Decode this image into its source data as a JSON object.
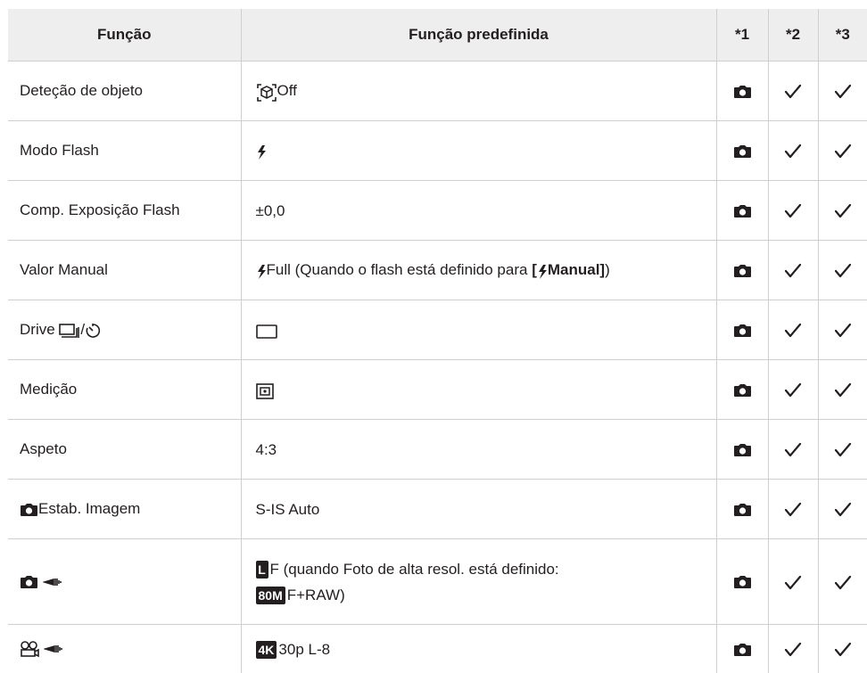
{
  "header": {
    "col_function": "Função",
    "col_default": "Função predefinida",
    "col_1": "*1",
    "col_2": "*2",
    "col_3": "*3"
  },
  "rows": [
    {
      "function": "Deteção de objeto",
      "default": "Off",
      "icons": [
        "object-detect-icon"
      ]
    },
    {
      "function": "Modo Flash",
      "default": "",
      "icons": [
        "flash-icon"
      ]
    },
    {
      "function": "Comp. Exposição Flash",
      "default": "±0,0"
    },
    {
      "function": "Valor Manual",
      "default_prefix": "Full (Quando o flash está definido para ",
      "default_bold": "[",
      "default_bold_2": "Manual]",
      "default_suffix": ")",
      "icons": [
        "flash-icon"
      ]
    },
    {
      "function": "Drive",
      "function_sep": "/",
      "default": "",
      "icons": [
        "sequential-shooting-icon",
        "self-timer-icon",
        "single-frame-icon"
      ]
    },
    {
      "function": "Medição",
      "default": "",
      "icons": [
        "metering-icon"
      ]
    },
    {
      "function": "Aspeto",
      "default": "4:3"
    },
    {
      "function": "Estab. Imagem",
      "default": "S-IS Auto",
      "icons": [
        "camera-icon"
      ]
    },
    {
      "function": "",
      "default_line1": "F (quando Foto de alta resol. está definido:",
      "default_line2": "F+RAW)",
      "badge_l": "L",
      "badge_80m": "80M",
      "icons": [
        "camera-icon",
        "image-quality-icon"
      ]
    },
    {
      "function": "",
      "default": "30p L-8",
      "badge_4k": "4K",
      "icons": [
        "movie-icon",
        "image-quality-icon"
      ]
    }
  ],
  "marks": {
    "col1": "camera-icon",
    "col2": "checkmark-icon",
    "col3": "checkmark-icon"
  }
}
